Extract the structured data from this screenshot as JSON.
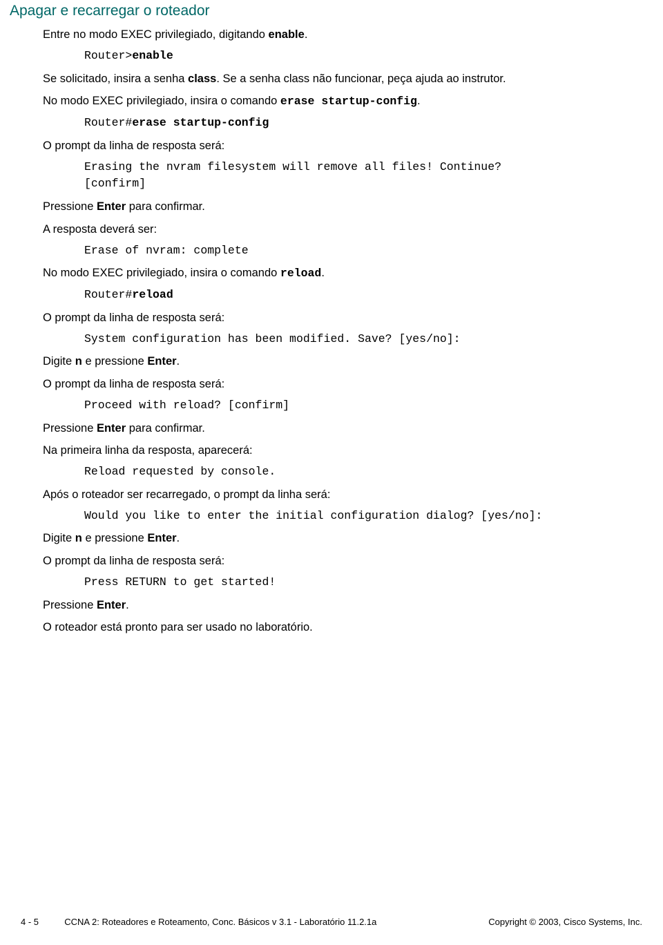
{
  "title": "Apagar e recarregar o roteador",
  "p1_a": "Entre no modo EXEC privilegiado, digitando ",
  "p1_b": "enable",
  "p1_c": ".",
  "c1_a": "Router>",
  "c1_b": "enable",
  "p2_a": "Se solicitado, insira a senha ",
  "p2_b": "class",
  "p2_c": ". Se a senha class não funcionar, peça ajuda ao instrutor.",
  "p3_a": "No modo EXEC privilegiado, insira o comando ",
  "p3_b": "erase startup-config",
  "p3_c": ".",
  "c2_a": "Router#",
  "c2_b": "erase startup-config",
  "p4": "O prompt da linha de resposta será:",
  "c3": "Erasing the nvram filesystem will remove all files! Continue?\n[confirm]",
  "p5_a": "Pressione ",
  "p5_b": "Enter",
  "p5_c": " para confirmar.",
  "p6": "A resposta deverá ser:",
  "c4": "Erase of nvram: complete",
  "p7_a": "No modo EXEC privilegiado, insira o comando ",
  "p7_b": "reload",
  "p7_c": ".",
  "c5_a": "Router#",
  "c5_b": "reload",
  "p8": "O prompt da linha de resposta será:",
  "c6": "System configuration has been modified. Save? [yes/no]:",
  "p9_a": "Digite ",
  "p9_b": "n",
  "p9_c": " e pressione ",
  "p9_d": "Enter",
  "p9_e": ".",
  "p10": "O prompt da linha de resposta será:",
  "c7": "Proceed with reload? [confirm]",
  "p11_a": "Pressione ",
  "p11_b": "Enter",
  "p11_c": " para confirmar.",
  "p12": "Na primeira linha da resposta, aparecerá:",
  "c8": "Reload requested by console.",
  "p13": "Após o roteador ser recarregado, o prompt da linha será:",
  "c9": "Would you like to enter the initial configuration dialog? [yes/no]:",
  "p14_a": "Digite ",
  "p14_b": "n",
  "p14_c": " e pressione ",
  "p14_d": "Enter",
  "p14_e": ".",
  "p15": "O prompt da linha de resposta será:",
  "c10": "Press RETURN to get started!",
  "p16_a": "Pressione ",
  "p16_b": "Enter",
  "p16_c": ".",
  "p17": "O roteador está pronto para ser usado no laboratório.",
  "footer_left": "4 - 5",
  "footer_mid": "CCNA 2: Roteadores e Roteamento, Conc. Básicos v 3.1 - Laboratório 11.2.1a",
  "footer_right": "Copyright © 2003, Cisco Systems, Inc."
}
